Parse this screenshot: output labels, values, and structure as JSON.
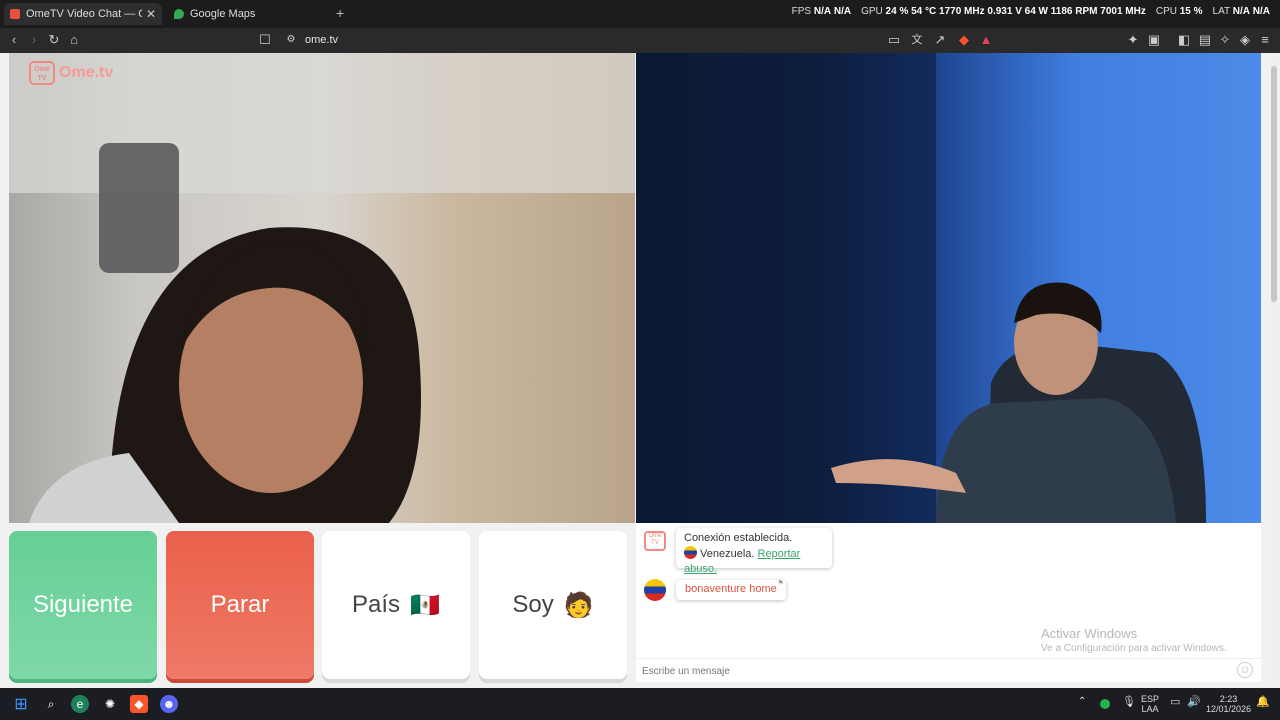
{
  "browser": {
    "tabs": [
      {
        "title": "OmeTV Video Chat — Omeg",
        "close": "✕"
      },
      {
        "title": "Google Maps"
      }
    ],
    "new_tab": "+",
    "url": "ome.tv",
    "overlay": {
      "fps_label": "FPS",
      "fps_value1": "N/A",
      "fps_value2": "N/A",
      "gpu_label": "GPU",
      "gpu_load": "24 %",
      "gpu_temp": "54 °C",
      "gpu_clock": "1770 MHz",
      "gpu_volt": "0.931 V",
      "gpu_power": "64 W",
      "gpu_rpm": "1186 RPM",
      "gpu_mem": "7001 MHz",
      "cpu_label": "CPU",
      "cpu_load": "15 %",
      "lat_label": "LAT",
      "lat_value1": "N/A",
      "lat_value2": "N/A"
    }
  },
  "page": {
    "logo_text": "Ome.tv",
    "logo_badge": "Ome TV",
    "buttons": {
      "next": "Siguiente",
      "stop": "Parar",
      "country": "País",
      "soy": "Soy"
    },
    "country_flag_emoji": "🇲🇽",
    "soy_emoji": "🧑"
  },
  "chat": {
    "system_line1": "Conexión establecida.",
    "country_name": "Venezuela.",
    "report_link": "Reportar abuso.",
    "message": "bonaventure home",
    "input_placeholder": "Escribe un mensaje",
    "watermark_title": "Activar Windows",
    "watermark_sub": "Ve a Configuración para activar Windows."
  },
  "taskbar": {
    "lang": "ESP",
    "lang_sub": "LAA",
    "time": "2:23",
    "date": "12/01/2026"
  }
}
